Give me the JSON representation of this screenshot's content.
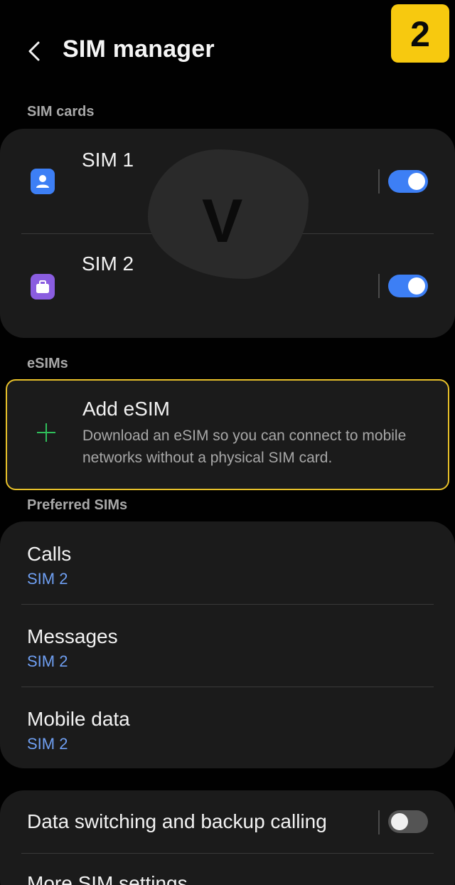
{
  "header": {
    "title": "SIM manager",
    "step_badge": "2",
    "back_icon": "chevron-left-icon"
  },
  "sim_cards": {
    "section_label": "SIM cards",
    "items": [
      {
        "label": "SIM 1",
        "icon": "person-sim-icon",
        "icon_color": "#3d7ff5",
        "enabled": true
      },
      {
        "label": "SIM 2",
        "icon": "briefcase-sim-icon",
        "icon_color": "#8a5de0",
        "enabled": true
      }
    ],
    "watermark_letter": "V"
  },
  "esims": {
    "section_label": "eSIMs",
    "add_title": "Add eSIM",
    "add_description": "Download an eSIM so you can connect to mobile networks without a physical SIM card.",
    "highlight_color": "#e8c12a",
    "plus_icon_color": "#2fbf5a"
  },
  "preferred_sims": {
    "section_label": "Preferred SIMs",
    "items": [
      {
        "label": "Calls",
        "value": "SIM 2"
      },
      {
        "label": "Messages",
        "value": "SIM 2"
      },
      {
        "label": "Mobile data",
        "value": "SIM 2"
      }
    ]
  },
  "more": {
    "data_switching_label": "Data switching and backup calling",
    "data_switching_enabled": false,
    "more_settings_label": "More SIM settings"
  },
  "colors": {
    "background": "#010101",
    "card": "#1b1b1b",
    "accent_toggle": "#3d7ff5",
    "link_value": "#6f9ff2",
    "badge": "#f7c90f"
  }
}
